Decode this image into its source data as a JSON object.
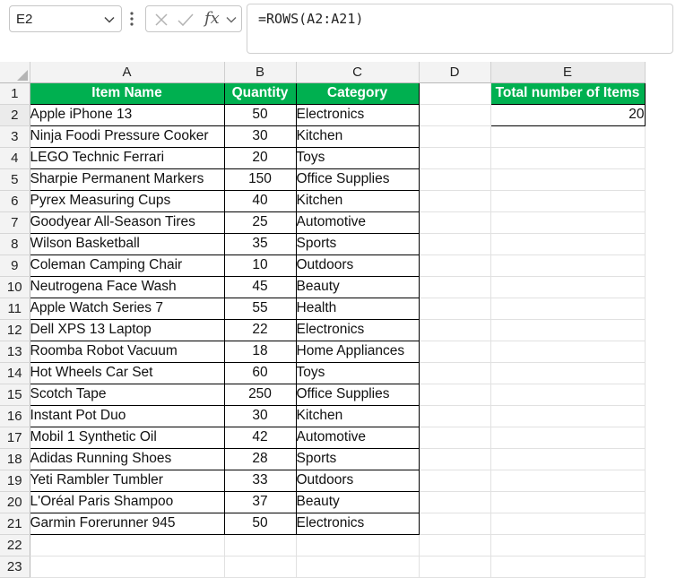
{
  "formula_bar": {
    "name_box": "E2",
    "fx": "fx",
    "formula": "=ROWS(A2:A21)"
  },
  "columns": [
    "A",
    "B",
    "C",
    "D",
    "E"
  ],
  "headers": {
    "item_name": "Item Name",
    "quantity": "Quantity",
    "category": "Category",
    "total_label": "Total number of Items"
  },
  "total_value": "20",
  "items": [
    {
      "name": "Apple iPhone 13",
      "qty": "50",
      "category": "Electronics"
    },
    {
      "name": "Ninja Foodi Pressure Cooker",
      "qty": "30",
      "category": "Kitchen"
    },
    {
      "name": "LEGO Technic Ferrari",
      "qty": "20",
      "category": "Toys"
    },
    {
      "name": "Sharpie Permanent Markers",
      "qty": "150",
      "category": "Office Supplies"
    },
    {
      "name": "Pyrex Measuring Cups",
      "qty": "40",
      "category": "Kitchen"
    },
    {
      "name": "Goodyear All-Season Tires",
      "qty": "25",
      "category": "Automotive"
    },
    {
      "name": "Wilson Basketball",
      "qty": "35",
      "category": "Sports"
    },
    {
      "name": "Coleman Camping Chair",
      "qty": "10",
      "category": "Outdoors"
    },
    {
      "name": "Neutrogena Face Wash",
      "qty": "45",
      "category": "Beauty"
    },
    {
      "name": "Apple Watch Series 7",
      "qty": "55",
      "category": "Health"
    },
    {
      "name": "Dell XPS 13 Laptop",
      "qty": "22",
      "category": "Electronics"
    },
    {
      "name": "Roomba Robot Vacuum",
      "qty": "18",
      "category": "Home Appliances"
    },
    {
      "name": "Hot Wheels Car Set",
      "qty": "60",
      "category": "Toys"
    },
    {
      "name": "Scotch Tape",
      "qty": "250",
      "category": "Office Supplies"
    },
    {
      "name": "Instant Pot Duo",
      "qty": "30",
      "category": "Kitchen"
    },
    {
      "name": "Mobil 1 Synthetic Oil",
      "qty": "42",
      "category": "Automotive"
    },
    {
      "name": "Adidas Running Shoes",
      "qty": "28",
      "category": "Sports"
    },
    {
      "name": "Yeti Rambler Tumbler",
      "qty": "33",
      "category": "Outdoors"
    },
    {
      "name": "L'Oréal Paris Shampoo",
      "qty": "37",
      "category": "Beauty"
    },
    {
      "name": "Garmin Forerunner 945",
      "qty": "50",
      "category": "Electronics"
    }
  ],
  "row_numbers": [
    "1",
    "2",
    "3",
    "4",
    "5",
    "6",
    "7",
    "8",
    "9",
    "10",
    "11",
    "12",
    "13",
    "14",
    "15",
    "16",
    "17",
    "18",
    "19",
    "20",
    "21",
    "22",
    "23"
  ]
}
